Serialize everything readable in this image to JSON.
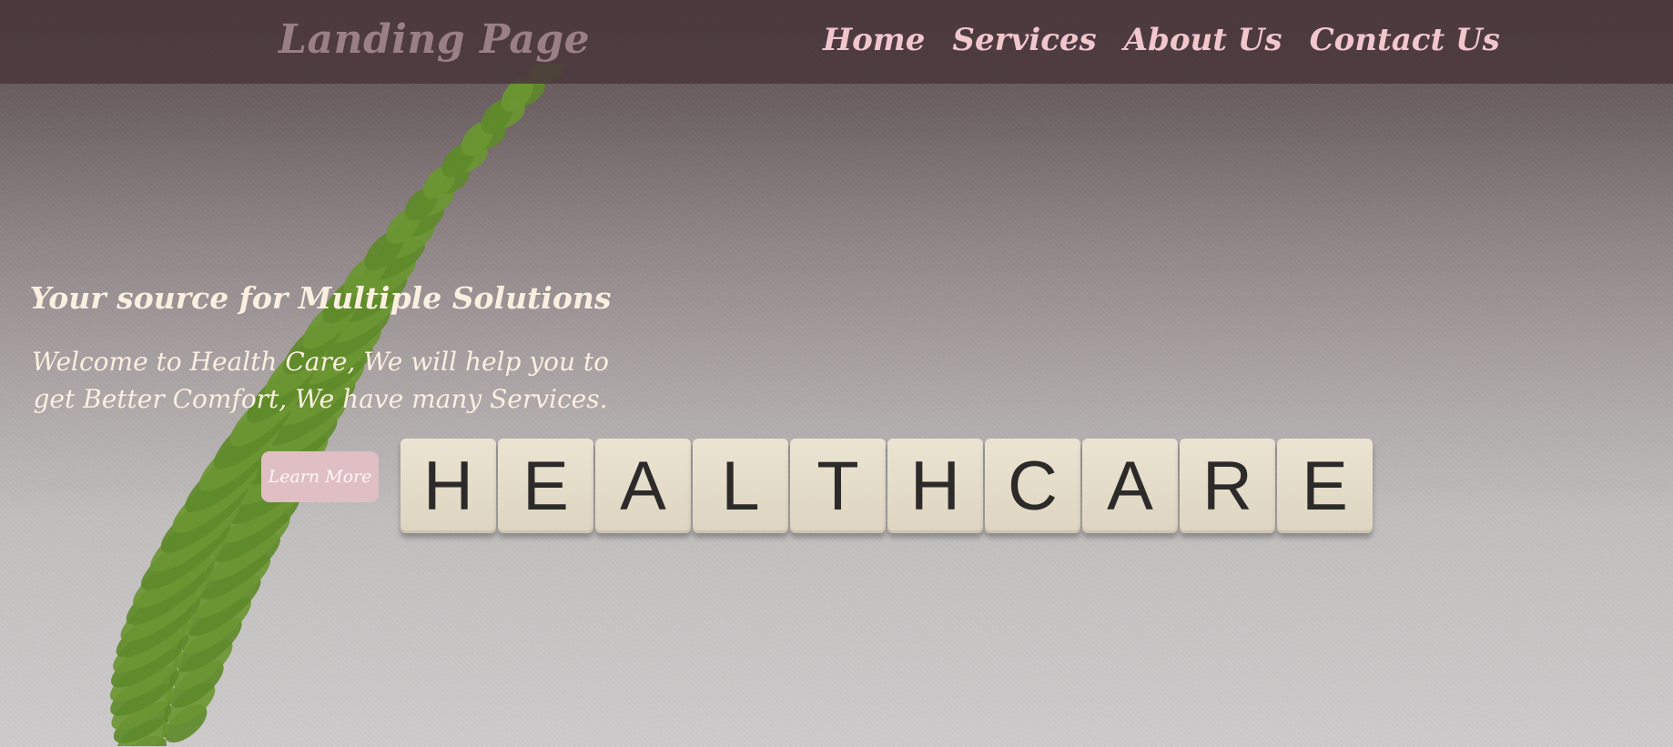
{
  "header": {
    "brand": "Landing Page",
    "nav": [
      {
        "label": "Home"
      },
      {
        "label": "Services"
      },
      {
        "label": "About Us"
      },
      {
        "label": "Contact Us"
      }
    ]
  },
  "hero": {
    "title": "Your source for Multiple Solutions",
    "subtitle": "Welcome to Health Care, We will help you to get Better Comfort, We have many Services.",
    "button_label": "Learn More"
  },
  "background": {
    "tiles": [
      "H",
      "E",
      "A",
      "L",
      "T",
      "H",
      "C",
      "A",
      "R",
      "E"
    ]
  },
  "colors": {
    "header_bg": "#4a383c",
    "nav_text": "#f1c6cc",
    "brand_text": "#9a7f86",
    "hero_text": "#fbefe0",
    "button_bg": "#dfbec4"
  }
}
